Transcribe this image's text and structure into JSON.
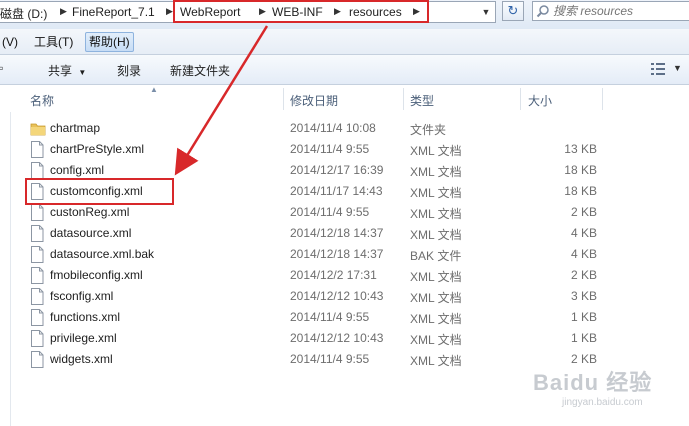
{
  "address": {
    "crumbs": [
      "磁盘 (D:)",
      "FineReport_7.1",
      "WebReport",
      "WEB-INF",
      "resources"
    ]
  },
  "search": {
    "placeholder": "搜索 resources"
  },
  "menu": {
    "items": [
      "(V)",
      "工具(T)",
      "帮助(H)"
    ]
  },
  "toolbar": {
    "share_label": "共享",
    "burn_label": "刻录",
    "new_folder_label": "新建文件夹"
  },
  "columns": {
    "name": "名称",
    "date": "修改日期",
    "type": "类型",
    "size": "大小"
  },
  "files": [
    {
      "name": "chartmap",
      "date": "2014/11/4 10:08",
      "type": "文件夹",
      "size": "",
      "kind": "folder"
    },
    {
      "name": "chartPreStyle.xml",
      "date": "2014/11/4 9:55",
      "type": "XML 文档",
      "size": "13 KB",
      "kind": "file"
    },
    {
      "name": "config.xml",
      "date": "2014/12/17 16:39",
      "type": "XML 文档",
      "size": "18 KB",
      "kind": "file"
    },
    {
      "name": "customconfig.xml",
      "date": "2014/11/17 14:43",
      "type": "XML 文档",
      "size": "18 KB",
      "kind": "file"
    },
    {
      "name": "custonReg.xml",
      "date": "2014/11/4 9:55",
      "type": "XML 文档",
      "size": "2 KB",
      "kind": "file"
    },
    {
      "name": "datasource.xml",
      "date": "2014/12/18 14:37",
      "type": "XML 文档",
      "size": "4 KB",
      "kind": "file"
    },
    {
      "name": "datasource.xml.bak",
      "date": "2014/12/18 14:37",
      "type": "BAK 文件",
      "size": "4 KB",
      "kind": "file"
    },
    {
      "name": "fmobileconfig.xml",
      "date": "2014/12/2 17:31",
      "type": "XML 文档",
      "size": "2 KB",
      "kind": "file"
    },
    {
      "name": "fsconfig.xml",
      "date": "2014/12/12 10:43",
      "type": "XML 文档",
      "size": "3 KB",
      "kind": "file"
    },
    {
      "name": "functions.xml",
      "date": "2014/11/4 9:55",
      "type": "XML 文档",
      "size": "1 KB",
      "kind": "file"
    },
    {
      "name": "privilege.xml",
      "date": "2014/12/12 10:43",
      "type": "XML 文档",
      "size": "1 KB",
      "kind": "file"
    },
    {
      "name": "widgets.xml",
      "date": "2014/11/4 9:55",
      "type": "XML 文档",
      "size": "2 KB",
      "kind": "file"
    }
  ],
  "watermark": {
    "text": "Baidu 经验",
    "sub": "jingyan.baidu.com"
  },
  "colors": {
    "annotation": "#d8282a",
    "folder": "#e8c15a",
    "menu_active": "#c7ddf5"
  }
}
